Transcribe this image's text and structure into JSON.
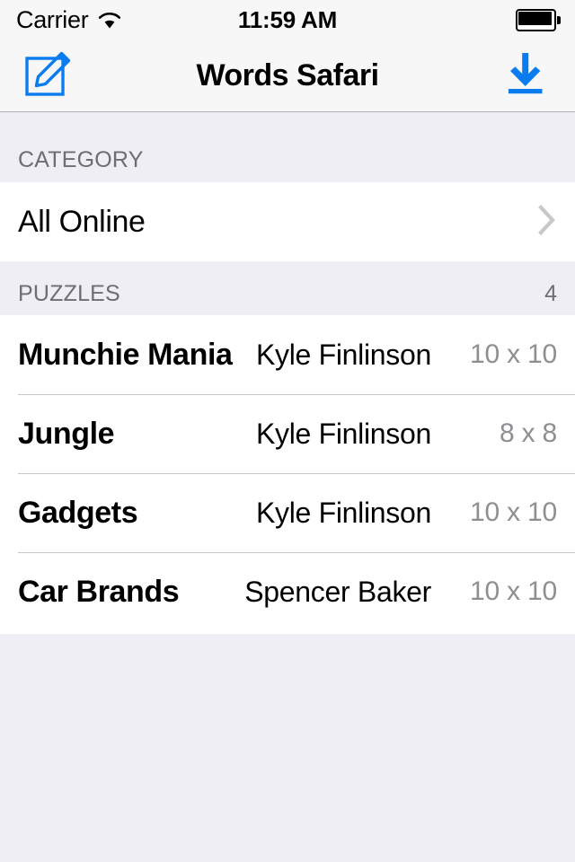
{
  "status_bar": {
    "carrier": "Carrier",
    "wifi_icon": "wifi-icon",
    "time": "11:59 AM",
    "battery_icon": "battery-full-icon"
  },
  "nav_bar": {
    "title": "Words Safari",
    "left_button_icon": "compose-icon",
    "right_button_icon": "download-icon",
    "tint_color": "#0a7cf0"
  },
  "sections": {
    "category": {
      "header": "CATEGORY",
      "count": "",
      "rows": [
        {
          "label": "All Online",
          "accessory": "chevron-right-icon"
        }
      ]
    },
    "puzzles": {
      "header": "PUZZLES",
      "count": "4",
      "rows": [
        {
          "title": "Munchie Mania",
          "author": "Kyle Finlinson",
          "size": "10 x 10"
        },
        {
          "title": "Jungle",
          "author": "Kyle Finlinson",
          "size": "8 x 8"
        },
        {
          "title": "Gadgets",
          "author": "Kyle Finlinson",
          "size": "10 x 10"
        },
        {
          "title": "Car Brands",
          "author": "Spencer Baker",
          "size": "10 x 10"
        }
      ]
    }
  },
  "colors": {
    "background": "#efeef4",
    "cell_background": "#ffffff",
    "separator": "#c8c7cc",
    "header_text": "#6d6d72",
    "secondary_text": "#8e8e93",
    "tint": "#0a7cf0"
  }
}
